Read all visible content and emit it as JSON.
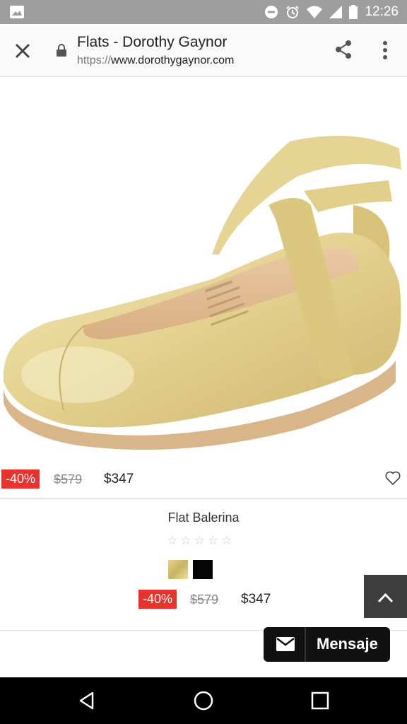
{
  "status_bar": {
    "time": "12:26",
    "icons": [
      "image-icon",
      "dnd-icon",
      "alarm-icon",
      "wifi-icon",
      "signal-icon",
      "battery-icon"
    ]
  },
  "toolbar": {
    "title": "Flats - Dorothy Gaynor",
    "url_scheme": "https://",
    "url_host": "www.dorothygaynor.com"
  },
  "product": {
    "image_alt": "gold ballerina flat shoe",
    "discount": "-40%",
    "old_price": "$579",
    "new_price": "$347",
    "name": "Flat Balerina",
    "rating_stars": "☆☆☆☆☆",
    "colors": [
      "#d4c06e",
      "#050505"
    ]
  },
  "chat": {
    "label": "Mensaje"
  },
  "colors": {
    "discount_red": "#e8322d",
    "status_bar": "#9e9e9e"
  }
}
